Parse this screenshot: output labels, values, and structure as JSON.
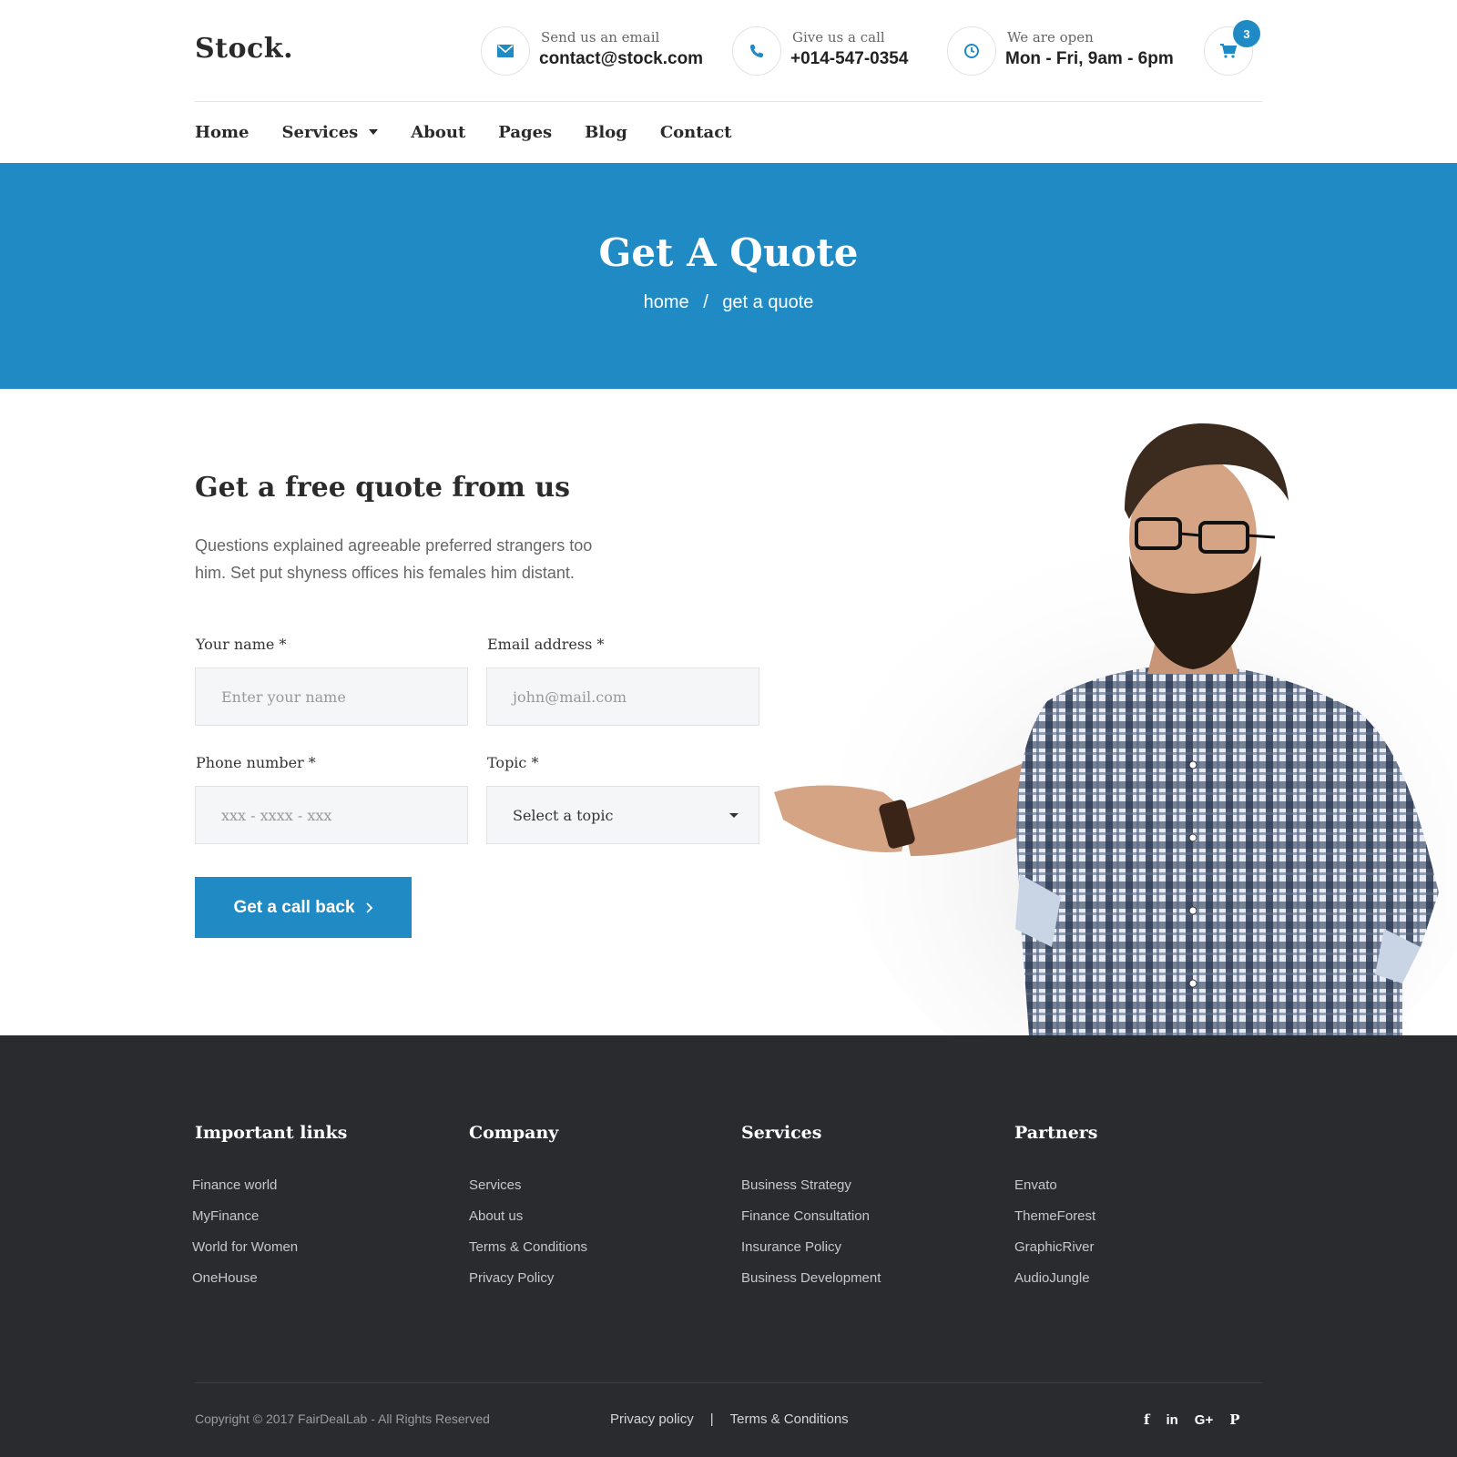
{
  "brand": {
    "logo": "Stock.",
    "accent": "#1f8ac3"
  },
  "header": {
    "email": {
      "icon": "envelope-icon",
      "label": "Send us an email",
      "value": "contact@stock.com"
    },
    "phone": {
      "icon": "phone-icon",
      "label": "Give us a call",
      "value": "+014-547-0354"
    },
    "hours": {
      "icon": "clock-icon",
      "label": "We are open",
      "value": "Mon - Fri, 9am - 6pm"
    },
    "cart": {
      "icon": "cart-icon",
      "count": "3"
    }
  },
  "nav": [
    "Home",
    "Services",
    "About",
    "Pages",
    "Blog",
    "Contact"
  ],
  "hero": {
    "title": "Get A Quote",
    "breadcrumb": [
      "home",
      "/",
      "get a quote"
    ]
  },
  "main": {
    "title": "Get a free quote from us",
    "description": "Questions explained agreeable preferred strangers too him. Set put shyness offices his females him distant.",
    "form": {
      "name_label": "Your name *",
      "name_placeholder": "Enter your name",
      "email_label": "Email address *",
      "email_placeholder": "john@mail.com",
      "phone_label": "Phone number *",
      "phone_placeholder": "xxx - xxxx - xxx",
      "topic_label": "Topic *",
      "topic_selected": "Select a topic",
      "submit": "Get a call back",
      "submit_icon": "chevron-right-icon"
    }
  },
  "footer": {
    "columns": [
      {
        "title": "Important links",
        "items": [
          "Finance world",
          "MyFinance",
          "World for Women",
          "OneHouse"
        ]
      },
      {
        "title": "Company",
        "items": [
          "Services",
          "About us",
          "Terms & Conditions",
          "Privacy Policy"
        ]
      },
      {
        "title": "Services",
        "items": [
          "Business Strategy",
          "Finance Consultation",
          "Insurance Policy",
          "Business Development"
        ]
      },
      {
        "title": "Partners",
        "items": [
          "Envato",
          "ThemeForest",
          "GraphicRiver",
          "AudioJungle"
        ]
      }
    ],
    "copyright": "Copyright © 2017 FairDealLab - All Rights Reserved",
    "links": [
      "Privacy policy",
      "|",
      "Terms & Conditions"
    ],
    "social": [
      {
        "icon": "facebook-icon",
        "glyph": "f"
      },
      {
        "icon": "linkedin-icon",
        "glyph": "in"
      },
      {
        "icon": "google-plus-icon",
        "glyph": "G+"
      },
      {
        "icon": "pinterest-icon",
        "glyph": "P"
      }
    ]
  }
}
